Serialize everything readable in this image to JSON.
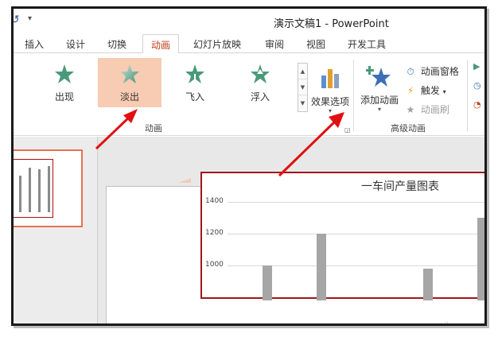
{
  "window": {
    "title": "演示文稿1 - PowerPoint"
  },
  "quick_access": {
    "undo_icon": "undo-icon",
    "dropdown_icon": "dropdown-icon"
  },
  "tabs": [
    {
      "label": "插入",
      "active": false
    },
    {
      "label": "设计",
      "active": false
    },
    {
      "label": "切换",
      "active": false
    },
    {
      "label": "动画",
      "active": true
    },
    {
      "label": "幻灯片放映",
      "active": false
    },
    {
      "label": "审阅",
      "active": false
    },
    {
      "label": "视图",
      "active": false
    },
    {
      "label": "开发工具",
      "active": false
    }
  ],
  "animation_group": {
    "label": "动画",
    "items": [
      {
        "label": "出现",
        "icon": "star-appear-icon",
        "selected": false
      },
      {
        "label": "淡出",
        "icon": "star-fade-icon",
        "selected": true
      },
      {
        "label": "飞入",
        "icon": "star-fly-icon",
        "selected": false
      },
      {
        "label": "浮入",
        "icon": "star-float-icon",
        "selected": false
      }
    ],
    "effect_options": {
      "label": "效果选项",
      "icon": "effect-options-icon"
    }
  },
  "advanced_group": {
    "label": "高级动画",
    "add_animation": {
      "label": "添加动画",
      "icon": "add-animation-star-icon"
    },
    "animation_pane": {
      "label": "动画窗格",
      "icon": "animation-pane-icon"
    },
    "trigger": {
      "label": "触发",
      "icon": "lightning-icon"
    },
    "animation_painter": {
      "label": "动画刷",
      "icon": "animation-painter-icon"
    }
  },
  "slide_chart": {
    "title": "一车间产量图表"
  },
  "chart_data": {
    "type": "bar",
    "title": "一车间产量图表",
    "yticks": [
      1400,
      1200,
      1000
    ],
    "visible_bars": [
      {
        "value": 1000
      },
      {
        "value": 1200
      },
      {
        "value": 980
      },
      {
        "value": 1300
      }
    ]
  },
  "colors": {
    "accent_tab": "#c43e1c",
    "selected_item": "#f8cbb3",
    "star_green": "#4a9a7a",
    "star_blue": "#3a6fb5",
    "slide_border": "#a0161c",
    "thumb_border": "#e2734e",
    "arrow_red": "#e01010",
    "bar_gray": "#a6a6a6"
  }
}
